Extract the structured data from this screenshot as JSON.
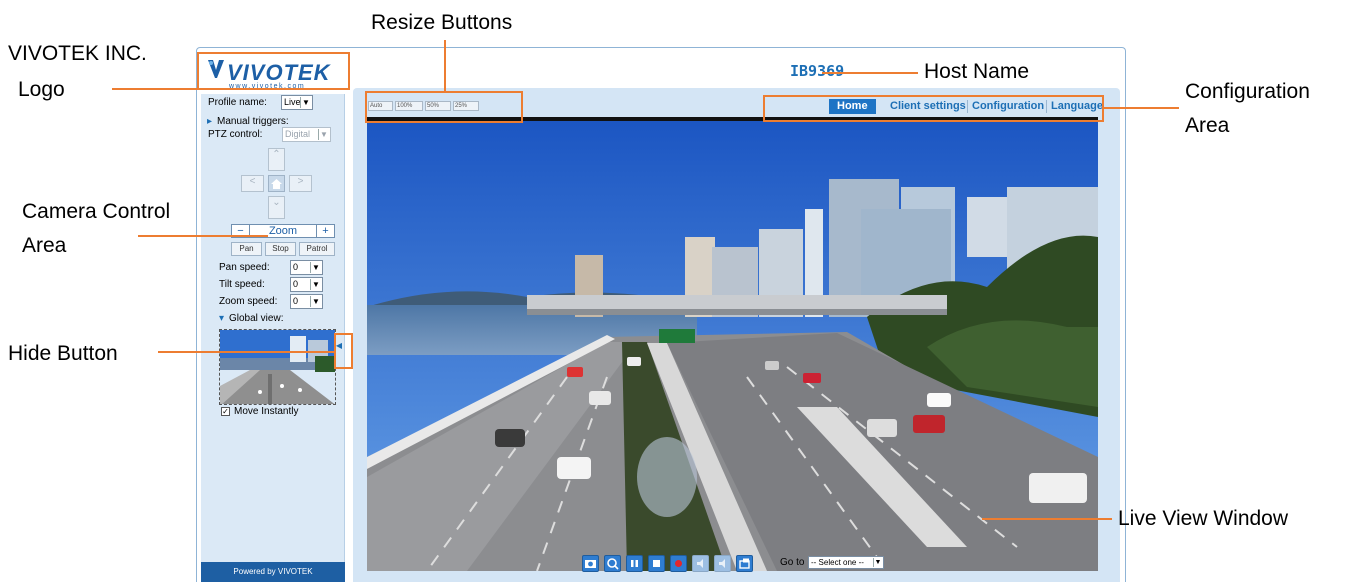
{
  "callouts": {
    "logo_line1": "VIVOTEK INC.",
    "logo_line2": "Logo",
    "resize_buttons": "Resize Buttons",
    "host_name": "Host Name",
    "configuration_line1": "Configuration",
    "configuration_line2": "Area",
    "camera_control_line1": "Camera Control",
    "camera_control_line2": "Area",
    "hide_button": "Hide Button",
    "live_view_window": "Live View Window"
  },
  "colors": {
    "accent": "#ED7D31",
    "brand_blue": "#1E74C5",
    "panel_blue": "#D4E5F5"
  },
  "logo": {
    "brand": "VIVOTEK",
    "url_text": "www.vivotek.com",
    "icon": "vivotek-logo-icon"
  },
  "host": {
    "name": "IB9369"
  },
  "sidebar": {
    "profile_label": "Profile name:",
    "profile_value": "Live",
    "manual_triggers": "Manual triggers:",
    "ptz_label": "PTZ control:",
    "ptz_value": "Digital",
    "zoom_minus": "−",
    "zoom_label": "Zoom",
    "zoom_plus": "+",
    "pan_btn": "Pan",
    "stop_btn": "Stop",
    "patrol_btn": "Patrol",
    "pan_speed_label": "Pan speed:",
    "pan_speed_value": "0",
    "tilt_speed_label": "Tilt speed:",
    "tilt_speed_value": "0",
    "zoom_speed_label": "Zoom speed:",
    "zoom_speed_value": "0",
    "global_view_label": "Global view:",
    "move_instantly_label": "Move Instantly",
    "move_instantly_checked": true,
    "powered_by": "Powered by VIVOTEK"
  },
  "resize": [
    {
      "label": "Auto"
    },
    {
      "label": "100%"
    },
    {
      "label": "50%"
    },
    {
      "label": "25%"
    }
  ],
  "nav": {
    "home": "Home",
    "client_settings": "Client settings",
    "configuration": "Configuration",
    "language": "Language"
  },
  "toolbar": {
    "icons": [
      "snapshot-icon",
      "digital-zoom-icon",
      "pause-icon",
      "stop-icon",
      "record-icon",
      "volume-icon",
      "mic-icon",
      "fullscreen-icon"
    ],
    "goto_label": "Go to",
    "goto_value": "-- Select one --"
  }
}
